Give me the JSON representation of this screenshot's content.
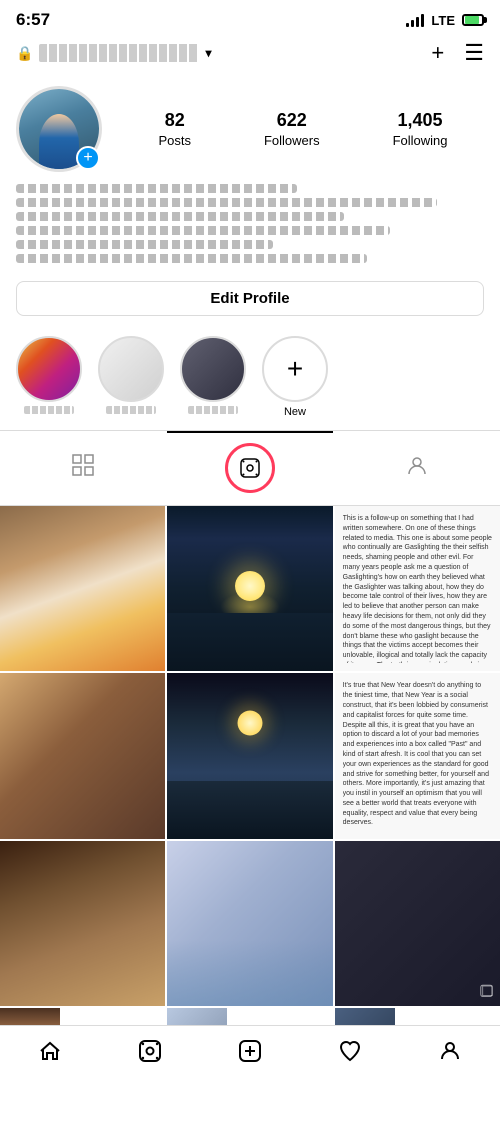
{
  "status": {
    "time": "6:57",
    "lte": "LTE"
  },
  "header": {
    "lock_icon": "🔒",
    "username_display": "username",
    "chevron": "▾",
    "add_label": "+",
    "menu_label": "☰"
  },
  "profile": {
    "add_icon": "+",
    "stats": [
      {
        "number": "82",
        "label": "Posts"
      },
      {
        "number": "622",
        "label": "Followers"
      },
      {
        "number": "1,405",
        "label": "Following"
      }
    ]
  },
  "edit_profile": {
    "label": "Edit Profile"
  },
  "highlights": [
    {
      "label": ""
    },
    {
      "label": ""
    },
    {
      "label": ""
    },
    {
      "label": "New"
    }
  ],
  "tabs": [
    {
      "id": "grid",
      "icon": "⊞"
    },
    {
      "id": "reels",
      "icon": "▶"
    },
    {
      "id": "tagged",
      "icon": "👤"
    }
  ],
  "grid_texts": {
    "cell6": "This is a follow-up on something that I had written somewhere. On one of these things related to media. This one is about some people who continually are Gaslighting the their selfish needs, shaming people and other evil.\n\nFor many years people ask me a question of Gaslighting's how on earth they believed what the Gaslighter was talking about, how they do become tale control of their lives, how they are led to believe that another person can make heavy life decisions for them, not only did they do some of the most dangerous things, but they don't blame these who gaslight because the things that the victims accept becomes their unlovable, illogical and totally lack the capacity of its core. The truth is, manipulative words is a systematic mist.",
    "cell9": "It's true that New Year doesn't do anything to the tiniest time, that New Year is a social construct, that it's been lobbied by consumerist and capitalist forces for quite some time.\n\nDespite all this, it is great that you have an option to discard a lot of your bad memories and experiences into a box called \"Past\" and kind of start afresh. It is cool that you can set your own experiences as the standard for good and strive for something better, for yourself and others. More importantly, it's just amazing that you instil in yourself an optimism that you will see a better world that treats everyone with equality, respect and value that every being deserves."
  },
  "bottom_nav": {
    "home": "🏠",
    "reels": "▶",
    "add": "+",
    "heart": "♡",
    "profile": "👤"
  }
}
